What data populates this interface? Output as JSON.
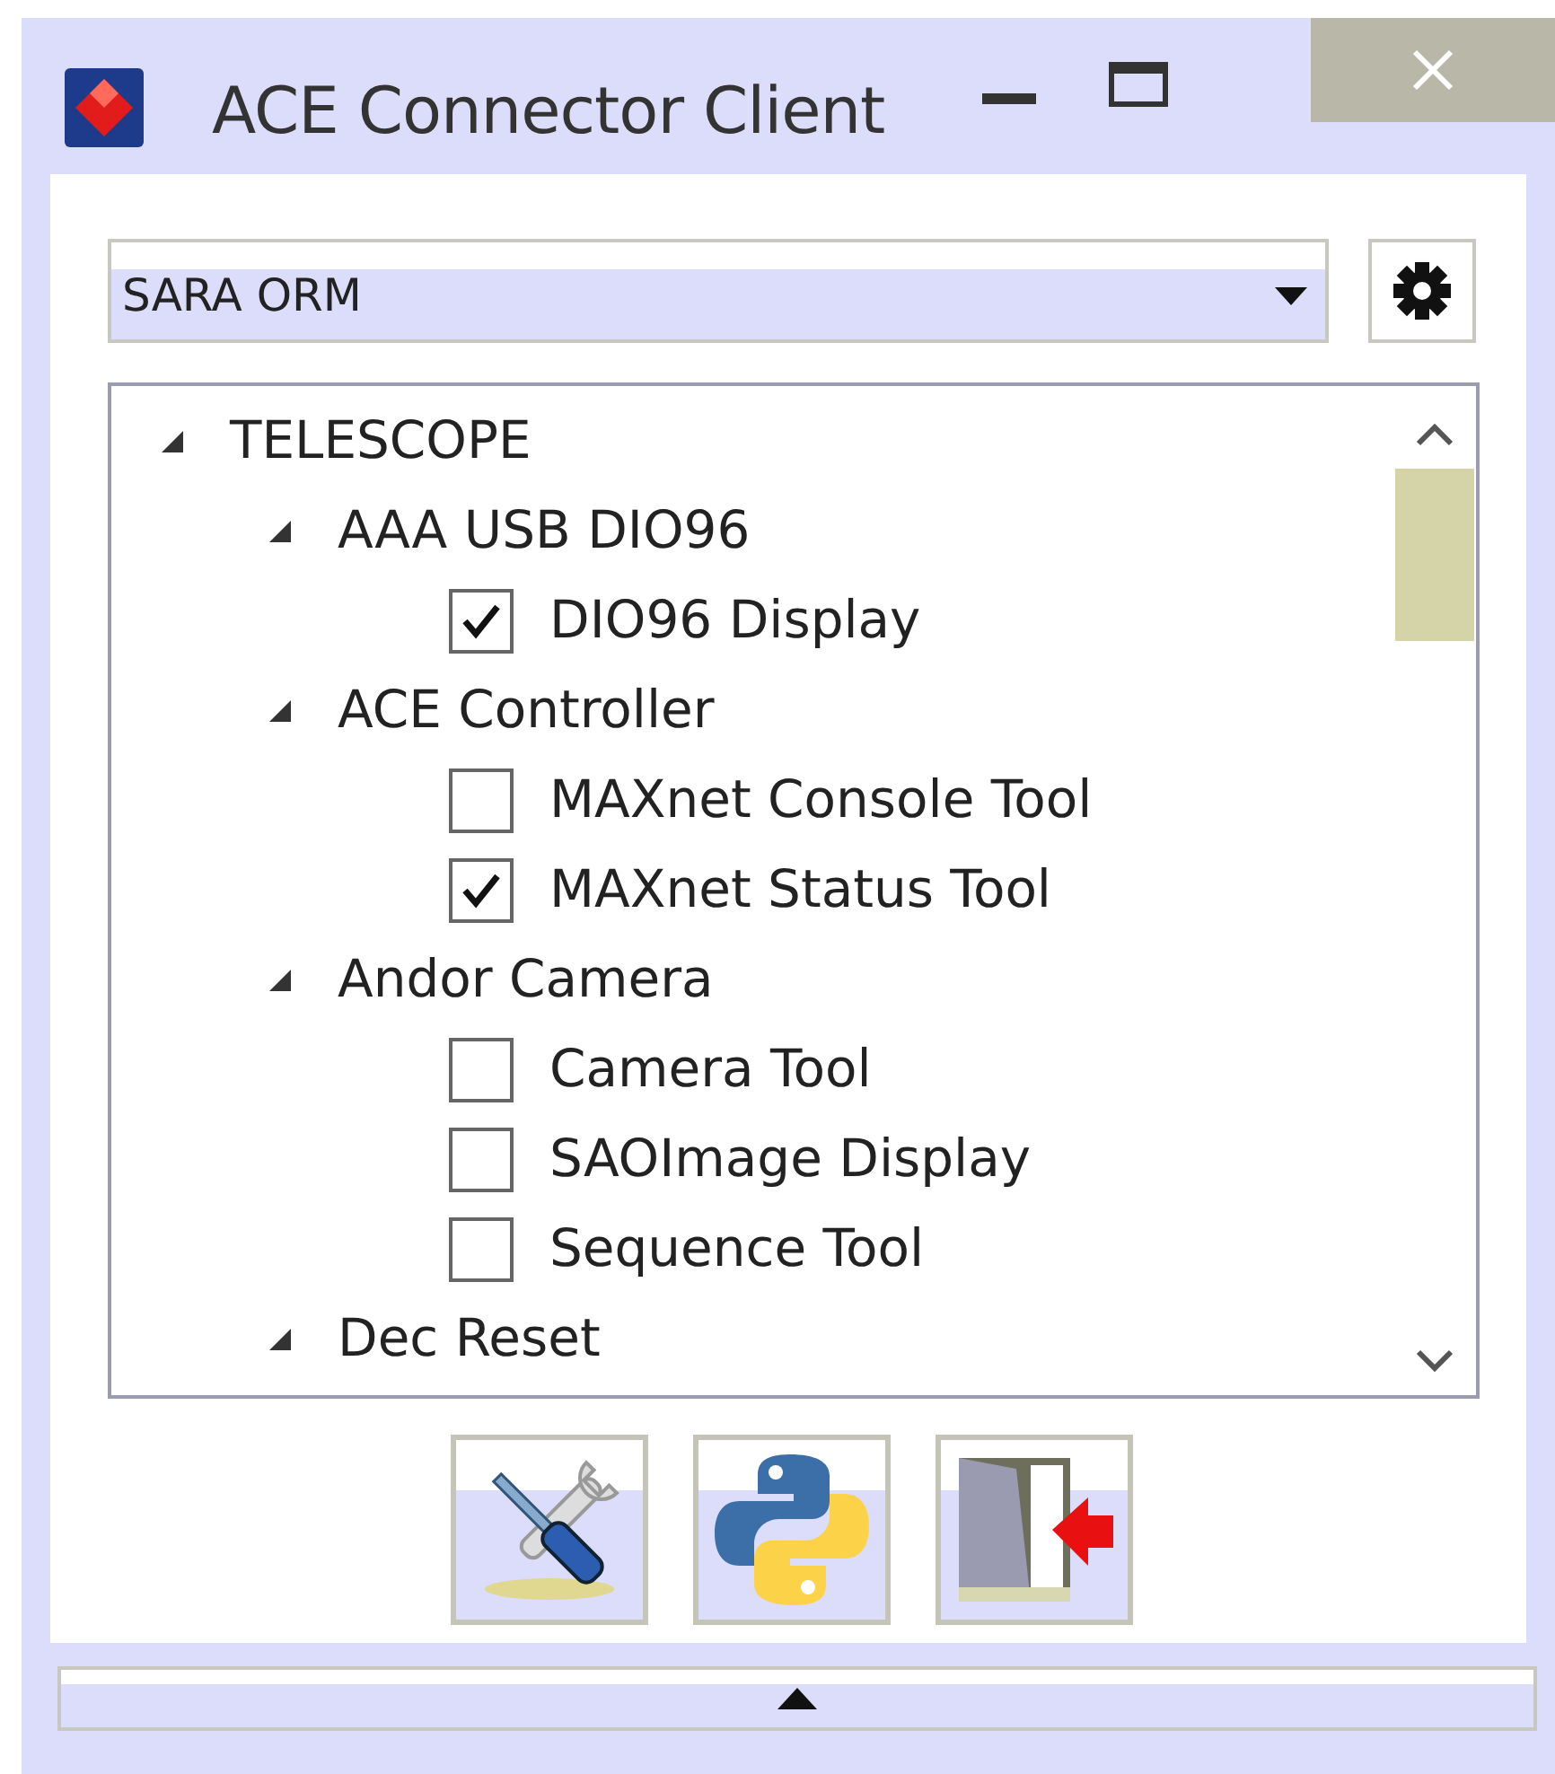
{
  "window": {
    "title": "ACE Connector Client"
  },
  "profile_select": {
    "value": "SARA ORM"
  },
  "tree": [
    {
      "label": "TELESCOPE",
      "expanded": true,
      "children": [
        {
          "label": "AAA USB DIO96",
          "expanded": true,
          "children": [
            {
              "label": "DIO96 Display",
              "checked": true
            }
          ]
        },
        {
          "label": "ACE Controller",
          "expanded": true,
          "children": [
            {
              "label": "MAXnet Console Tool",
              "checked": false
            },
            {
              "label": "MAXnet Status Tool",
              "checked": true
            }
          ]
        },
        {
          "label": "Andor Camera",
          "expanded": true,
          "children": [
            {
              "label": "Camera Tool",
              "checked": false
            },
            {
              "label": "SAOImage Display",
              "checked": false
            },
            {
              "label": "Sequence Tool",
              "checked": false
            }
          ]
        },
        {
          "label": "Dec Reset",
          "expanded": true
        }
      ]
    }
  ],
  "toolbar": [
    {
      "kind": "tools"
    },
    {
      "kind": "python"
    },
    {
      "kind": "exit"
    }
  ],
  "bottom_bar": {
    "expanded": false
  }
}
